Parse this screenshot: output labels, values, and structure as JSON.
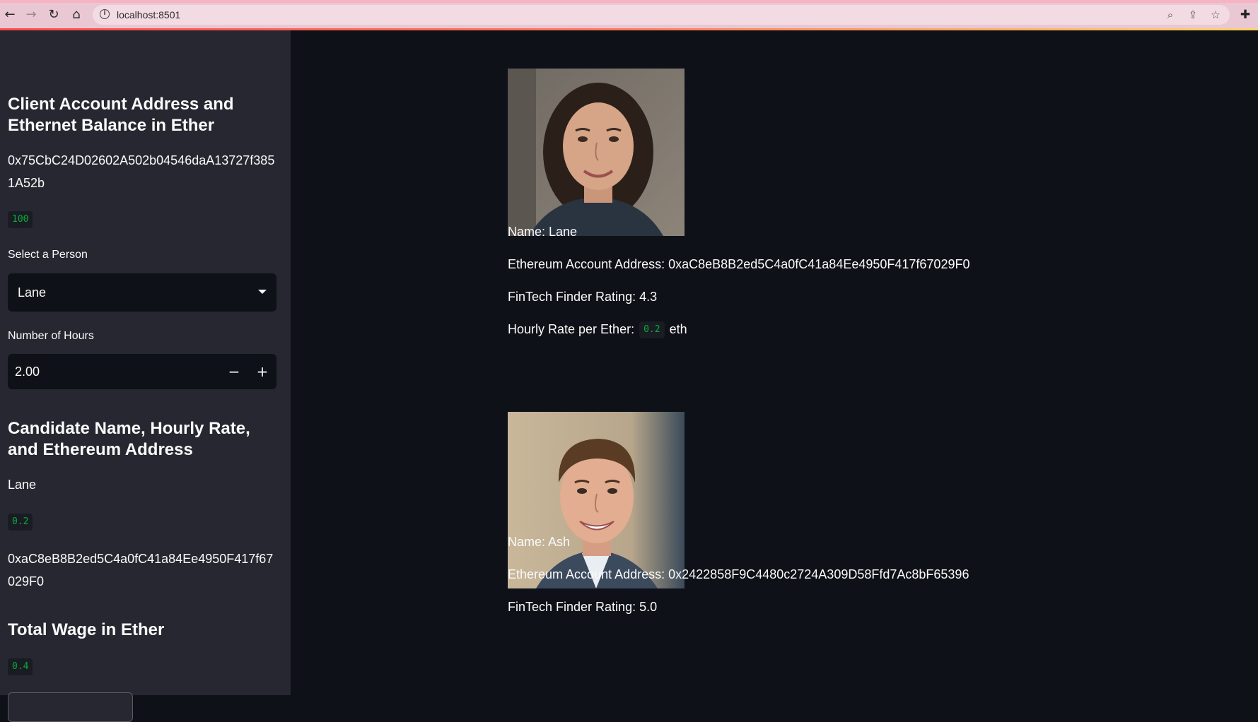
{
  "browser": {
    "url": "localhost:8501"
  },
  "sidebar": {
    "client_heading": "Client Account Address and Ethernet Balance in Ether",
    "client_address": "0x75CbC24D02602A502b04546daA13727f3851A52b",
    "client_balance": "100",
    "select_label": "Select a Person",
    "select_value": "Lane",
    "hours_label": "Number of Hours",
    "hours_value": "2.00",
    "hours_decrement": "−",
    "hours_increment": "+",
    "candidate_heading": "Candidate Name, Hourly Rate, and Ethereum Address",
    "candidate_name": "Lane",
    "candidate_rate": "0.2",
    "candidate_address": "0xaC8eB8B2ed5C4a0fC41a84Ee4950F417f67029F0",
    "wage_heading": "Total Wage in Ether",
    "wage_value": "0.4"
  },
  "candidates": [
    {
      "name_line": "Name: Lane",
      "address_line": "Ethereum Account Address: 0xaC8eB8B2ed5C4a0fC41a84Ee4950F417f67029F0",
      "rating_line": "FinTech Finder Rating: 4.3",
      "rate_prefix": "Hourly Rate per Ether:",
      "rate_value": "0.2",
      "rate_suffix": "eth"
    },
    {
      "name_line": "Name: Ash",
      "address_line": "Ethereum Account Address: 0x2422858F9C4480c2724A309D58Ffd7Ac8bF65396",
      "rating_line": "FinTech Finder Rating: 5.0"
    }
  ],
  "colors": {
    "app_background": "#0e1117",
    "sidebar_background": "#262730",
    "code_green": "#09ab3b",
    "browser_chrome": "#e9c8d3"
  }
}
